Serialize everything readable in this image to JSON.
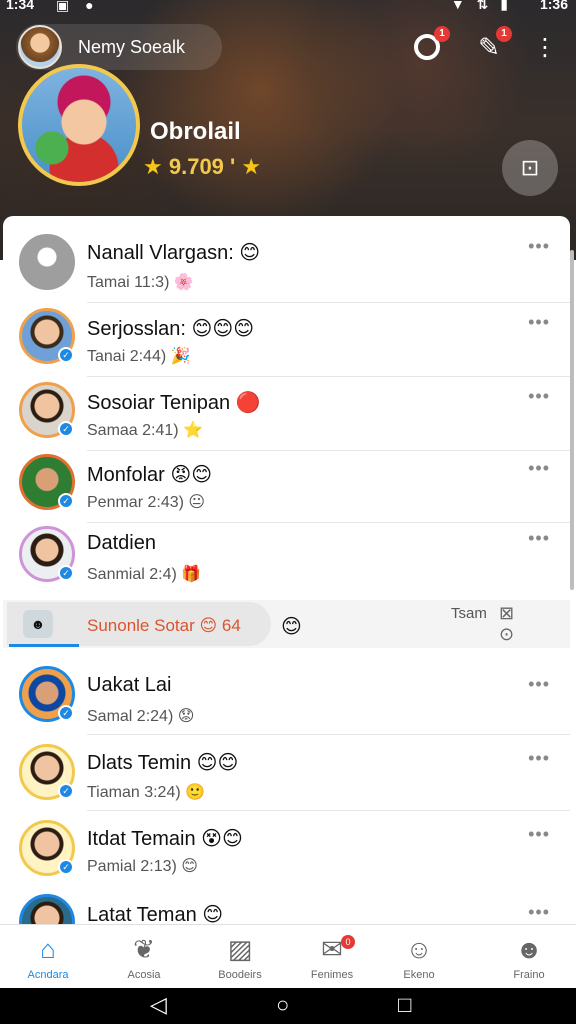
{
  "status_bar": {
    "time_left": "1:34",
    "icons_left": "▣ ●",
    "icons_right": "▼ ⇅ ▮",
    "time_right": "1:36"
  },
  "header": {
    "user_name": "Nemy Soealk",
    "badge_1": "1",
    "badge_2": "1",
    "profile_name": "Obrolail",
    "rating_text": "9.709 '",
    "icons": [
      "camera-icon",
      "user-plus-icon",
      "more-vert-icon",
      "qr-icon"
    ]
  },
  "list": [
    {
      "title": "Nanall Vlargasn: 😊",
      "sub": "Tamai 11:3) 🌸",
      "more": "•••",
      "avatar_color": "#9e9e9e"
    },
    {
      "title": "Serjosslan: 😊😊😊",
      "sub": "Tanai 2:44) 🎉",
      "more": "•••",
      "avatar_color": "#f0a04b"
    },
    {
      "title": "Sosoiar Tenipan 🔴",
      "sub": "Samaa 2:41) ⭐",
      "more": "•••",
      "avatar_color": "#f0a04b"
    },
    {
      "title": "Monfolar 😡😊",
      "sub": "Penmar 2:43) 😐",
      "more": "•••",
      "avatar_color": "#43a047"
    },
    {
      "title": "Datdien",
      "sub": "Sanmial 2:4) 🎁",
      "more": "•••",
      "avatar_color": "#ce93d8"
    },
    {
      "title": "Uakat Lai",
      "sub": "Samal 2:24) 😟",
      "more": "•••",
      "avatar_color": "#1e88e5"
    },
    {
      "title": "Dlats Temin 😊😊",
      "sub": "Tiaman 3:24) 🙂",
      "more": "•••",
      "avatar_color": "#f2c94c"
    },
    {
      "title": "Itdat Temain 😵😊",
      "sub": "Pamial 2:13) 😊",
      "more": "•••",
      "avatar_color": "#f2c94c"
    },
    {
      "title": "Latat Teman 😊",
      "sub": "",
      "more": "•••",
      "avatar_color": "#1e88e5"
    }
  ],
  "highlight": {
    "text": "Sunonle Sotar 😊 64",
    "emoji": "😊",
    "right_text": "Tsam",
    "right_icons": "⊠ ⊙"
  },
  "bottom_nav": [
    {
      "label": "Acndara",
      "icon": "home-icon",
      "glyph": "⌂",
      "active": true
    },
    {
      "label": "Acosia",
      "icon": "bird-icon",
      "glyph": "❦",
      "active": false
    },
    {
      "label": "Boodeirs",
      "icon": "image-icon",
      "glyph": "▨",
      "active": false
    },
    {
      "label": "Fenimes",
      "icon": "inbox-icon",
      "glyph": "✉",
      "active": false,
      "badge": "0"
    },
    {
      "label": "Ekeno",
      "icon": "person-icon",
      "glyph": "☺",
      "active": false
    },
    {
      "label": "Fraino",
      "icon": "profile-icon",
      "glyph": "☻",
      "active": false
    }
  ],
  "android_nav": {
    "back": "◁",
    "home": "○",
    "recents": "□"
  }
}
